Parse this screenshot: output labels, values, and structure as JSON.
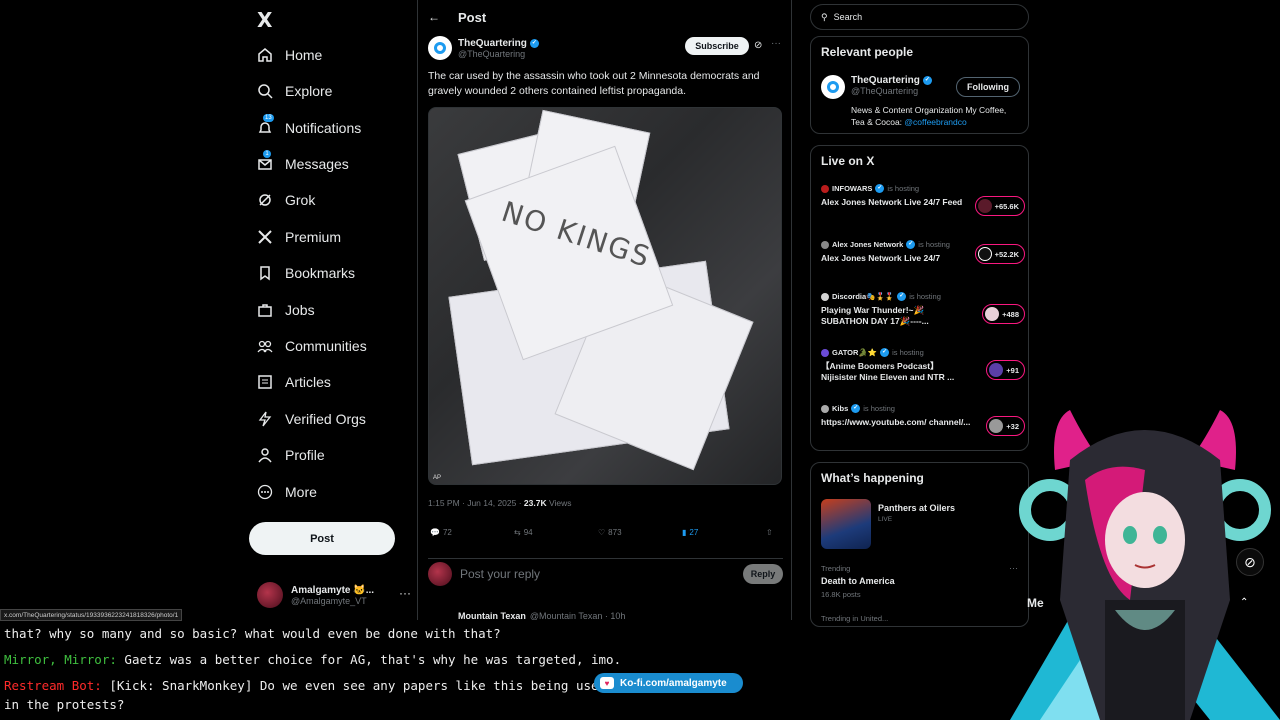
{
  "nav": {
    "logo": "X",
    "items": [
      {
        "label": "Home",
        "icon": "home-icon"
      },
      {
        "label": "Explore",
        "icon": "search-icon"
      },
      {
        "label": "Notifications",
        "icon": "bell-icon",
        "badge": "13"
      },
      {
        "label": "Messages",
        "icon": "mail-icon",
        "badge": "1"
      },
      {
        "label": "Grok",
        "icon": "grok-icon"
      },
      {
        "label": "Premium",
        "icon": "x-icon"
      },
      {
        "label": "Bookmarks",
        "icon": "bookmark-icon"
      },
      {
        "label": "Jobs",
        "icon": "briefcase-icon"
      },
      {
        "label": "Communities",
        "icon": "people-icon"
      },
      {
        "label": "Articles",
        "icon": "article-icon"
      },
      {
        "label": "Verified Orgs",
        "icon": "lightning-icon"
      },
      {
        "label": "Profile",
        "icon": "person-icon"
      },
      {
        "label": "More",
        "icon": "more-circle-icon"
      }
    ],
    "post_button": "Post",
    "account": {
      "name": "Amalgamyte 🐱...",
      "handle": "@Amalgamyte_VT"
    }
  },
  "main": {
    "header_title": "Post",
    "author": {
      "name": "TheQuartering",
      "handle": "@TheQuartering"
    },
    "subscribe": "Subscribe",
    "text": "The car used by the assassin who took out 2 Minnesota democrats and gravely wounded 2 others contained leftist propaganda.",
    "photo_text": {
      "sign": "NO KINGS",
      "credit": "AP"
    },
    "meta": {
      "time": "1:15 PM · Jun 14, 2025 · ",
      "views_count": "23.7K",
      "views_label": " Views"
    },
    "actions": {
      "replies": "72",
      "reposts": "94",
      "likes": "873",
      "bookmarks": "27"
    },
    "reply_placeholder": "Post your reply",
    "reply_button": "Reply",
    "next": {
      "name": "Mountain Texan",
      "handle": "@Mountain Texan · 10h"
    }
  },
  "side": {
    "search_placeholder": "Search",
    "relevant_title": "Relevant people",
    "relevant": {
      "name": "TheQuartering",
      "handle": "@TheQuartering",
      "button": "Following",
      "bio": "News & Content Organization My Coffee, Tea & Cocoa: ",
      "bio_link": "@coffeebrandco"
    },
    "live_title": "Live on X",
    "live": [
      {
        "host": "INFOWARS",
        "hosting": "is hosting",
        "title": "Alex Jones Network Live 24/7 Feed",
        "count": "+65.6K"
      },
      {
        "host": "Alex Jones Network",
        "hosting": "is hosting",
        "title": "Alex Jones Network Live 24/7",
        "count": "+52.2K"
      },
      {
        "host": "Discordia🎭🎖️🎖️",
        "hosting": "is hosting",
        "title": "Playing War Thunder!~🎉 SUBATHON DAY 17🎉----...",
        "count": "+488"
      },
      {
        "host": "GATOR🐊⭐",
        "hosting": "is hosting",
        "title": "【Anime Boomers Podcast】 Nijisister Nine Eleven and NTR ...",
        "count": "+91"
      },
      {
        "host": "Kibs",
        "hosting": "is hosting",
        "title": "https://www.youtube.com/ channel/...",
        "count": "+32"
      }
    ],
    "happening_title": "What’s happening",
    "happening": {
      "name": "Panthers at Oilers",
      "status": "LIVE"
    },
    "trend": {
      "label": "Trending",
      "name": "Death to America",
      "posts": "16.8K posts",
      "next_label": "Trending in United..."
    }
  },
  "overlay": {
    "status_url": "x.com/TheQuartering/status/1933936223241818326/photo/1",
    "chat": [
      {
        "who": "",
        "text": "that? why so many and so basic? what would even be done with that?",
        "color": "#eeeeee"
      },
      {
        "who": "Mirror, Mirror:",
        "text": " Gaetz was a better choice for AG, that's why he was targeted, imo.",
        "color": "#3fbf3f"
      },
      {
        "who": "Restream Bot:",
        "text": " [Kick: SnarkMonkey] Do we even see any papers like this being used",
        "color": "#ff2a2a"
      },
      {
        "who": "",
        "text": "in the protests?",
        "color": "#eeeeee"
      }
    ],
    "kofi": "Ko-fi.com/amalgamyte",
    "me_label": "Me"
  }
}
